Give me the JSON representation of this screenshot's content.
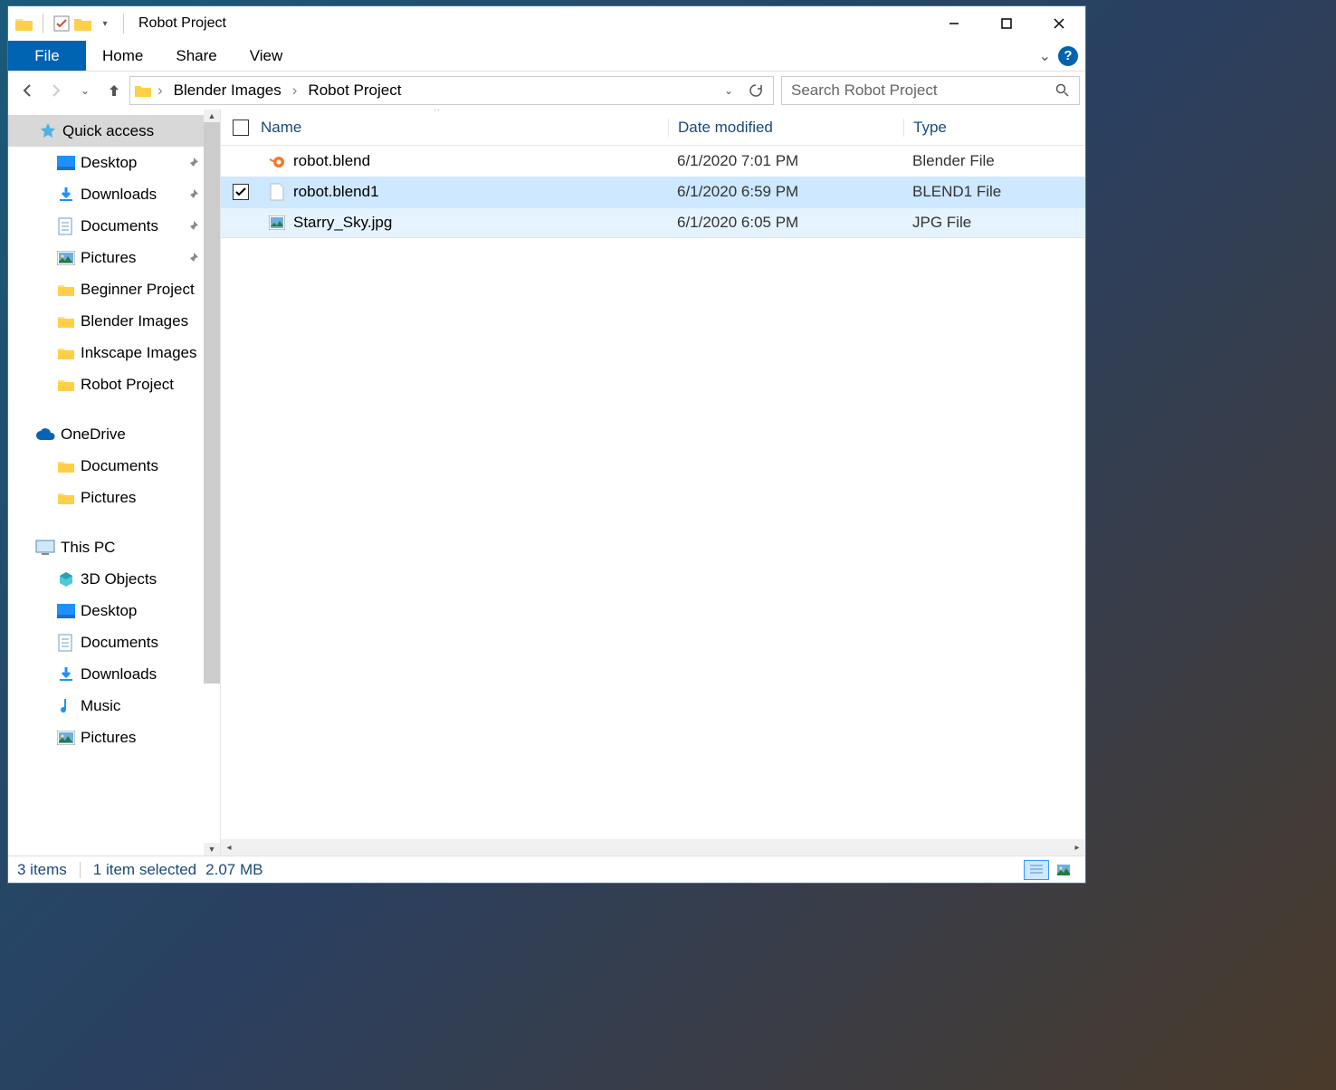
{
  "titlebar": {
    "title": "Robot Project"
  },
  "ribbon": {
    "file": "File",
    "tabs": [
      "Home",
      "Share",
      "View"
    ]
  },
  "breadcrumbs": [
    "Blender Images",
    "Robot Project"
  ],
  "search": {
    "placeholder": "Search Robot Project"
  },
  "sidebar": {
    "quick_access": {
      "label": "Quick access",
      "items": [
        {
          "label": "Desktop",
          "icon": "desktop",
          "pinned": true
        },
        {
          "label": "Downloads",
          "icon": "download",
          "pinned": true
        },
        {
          "label": "Documents",
          "icon": "document",
          "pinned": true
        },
        {
          "label": "Pictures",
          "icon": "pictures",
          "pinned": true
        },
        {
          "label": "Beginner Project",
          "icon": "folder",
          "pinned": false
        },
        {
          "label": "Blender Images",
          "icon": "folder",
          "pinned": false
        },
        {
          "label": "Inkscape Images",
          "icon": "folder",
          "pinned": false
        },
        {
          "label": "Robot Project",
          "icon": "folder",
          "pinned": false
        }
      ]
    },
    "onedrive": {
      "label": "OneDrive",
      "items": [
        {
          "label": "Documents",
          "icon": "folder"
        },
        {
          "label": "Pictures",
          "icon": "folder"
        }
      ]
    },
    "thispc": {
      "label": "This PC",
      "items": [
        {
          "label": "3D Objects",
          "icon": "3d"
        },
        {
          "label": "Desktop",
          "icon": "desktop"
        },
        {
          "label": "Documents",
          "icon": "document"
        },
        {
          "label": "Downloads",
          "icon": "download"
        },
        {
          "label": "Music",
          "icon": "music"
        },
        {
          "label": "Pictures",
          "icon": "pictures"
        }
      ]
    }
  },
  "columns": {
    "name": "Name",
    "date": "Date modified",
    "type": "Type"
  },
  "files": [
    {
      "name": "robot.blend",
      "date": "6/1/2020 7:01 PM",
      "type": "Blender File",
      "icon": "blender",
      "selected": false,
      "hover": false
    },
    {
      "name": "robot.blend1",
      "date": "6/1/2020 6:59 PM",
      "type": "BLEND1 File",
      "icon": "blank",
      "selected": true,
      "hover": false
    },
    {
      "name": "Starry_Sky.jpg",
      "date": "6/1/2020 6:05 PM",
      "type": "JPG File",
      "icon": "image",
      "selected": false,
      "hover": true
    }
  ],
  "status": {
    "count": "3 items",
    "selection": "1 item selected",
    "size": "2.07 MB"
  }
}
